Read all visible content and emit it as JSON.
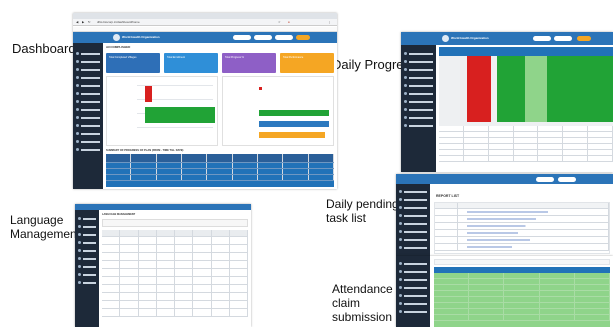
{
  "captions": {
    "dashboard": "Dashboard",
    "daily_progress": "Daily Progress",
    "language_management_line1": "Language",
    "language_management_line2": "Management",
    "daily_pending_line1": "Daily pending",
    "daily_pending_line2": "task list",
    "attendance_line1": "Attendance",
    "attendance_line2": "claim",
    "attendance_line3": "submission"
  },
  "dashboard_shot": {
    "browser_url": "dhis.biocorp.in/dashboard/home",
    "org_name": "World Health Organization",
    "section_title": "ACCOMPLISHED",
    "cards": [
      {
        "label": "Total Completed Villages",
        "color": "#2e6fb7"
      },
      {
        "label": "Total Enrollment",
        "color": "#2f8fd8"
      },
      {
        "label": "Total Progress %",
        "color": "#8e5fc6"
      },
      {
        "label": "Total Performance",
        "color": "#f5a623"
      }
    ],
    "summary_title": "SUMMARY OF PROGRESS OF PLAN (FROM - TIME TILL DATE)"
  },
  "daily_progress_shot": {
    "org_name": "World Health Organization"
  },
  "language_shot": {
    "title": "LANGUAGE MANAGEMENT"
  },
  "pending_shot": {
    "title": "REPORT LIST"
  },
  "colors": {
    "nav": "#1e2a3a",
    "header": "#2c79bf",
    "green": "#21a336",
    "red": "#d8201f",
    "light_green": "#8fd48a"
  }
}
